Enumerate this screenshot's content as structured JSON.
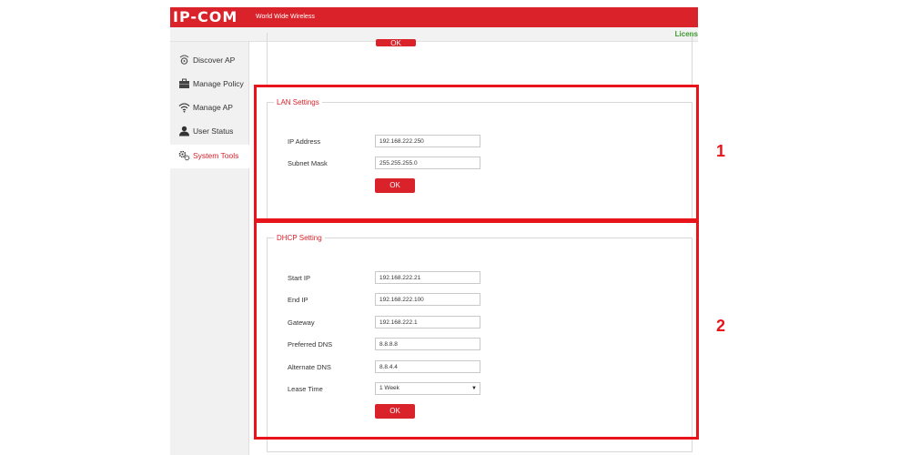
{
  "header": {
    "logo": "IP-COM",
    "tagline": "World Wide Wireless",
    "license": "Licens"
  },
  "sidebar": {
    "items": [
      {
        "label": "Discover AP",
        "icon": "discover-ap-icon"
      },
      {
        "label": "Manage Policy",
        "icon": "briefcase-icon"
      },
      {
        "label": "Manage AP",
        "icon": "wifi-icon"
      },
      {
        "label": "User Status",
        "icon": "user-icon"
      },
      {
        "label": "System Tools",
        "icon": "gear-icon",
        "active": true
      }
    ]
  },
  "prev_panel": {
    "ok_label": "OK"
  },
  "lan": {
    "title": "LAN Settings",
    "ip_label": "IP Address",
    "ip_value": "192.168.222.250",
    "mask_label": "Subnet Mask",
    "mask_value": "255.255.255.0",
    "ok_label": "OK"
  },
  "dhcp": {
    "title": "DHCP Setting",
    "start_label": "Start IP",
    "start_value": "192.168.222.21",
    "end_label": "End IP",
    "end_value": "192.168.222.100",
    "gateway_label": "Gateway",
    "gateway_value": "192.168.222.1",
    "pdns_label": "Preferred DNS",
    "pdns_value": "8.8.8.8",
    "adns_label": "Alternate DNS",
    "adns_value": "8.8.4.4",
    "lease_label": "Lease Time",
    "lease_value": "1 Week",
    "ok_label": "OK"
  },
  "annotations": {
    "callout_1": "1",
    "callout_2": "2",
    "highlight_color": "#e8141b"
  },
  "colors": {
    "brand_red": "#d9222a",
    "license_green": "#3a9b2a"
  }
}
